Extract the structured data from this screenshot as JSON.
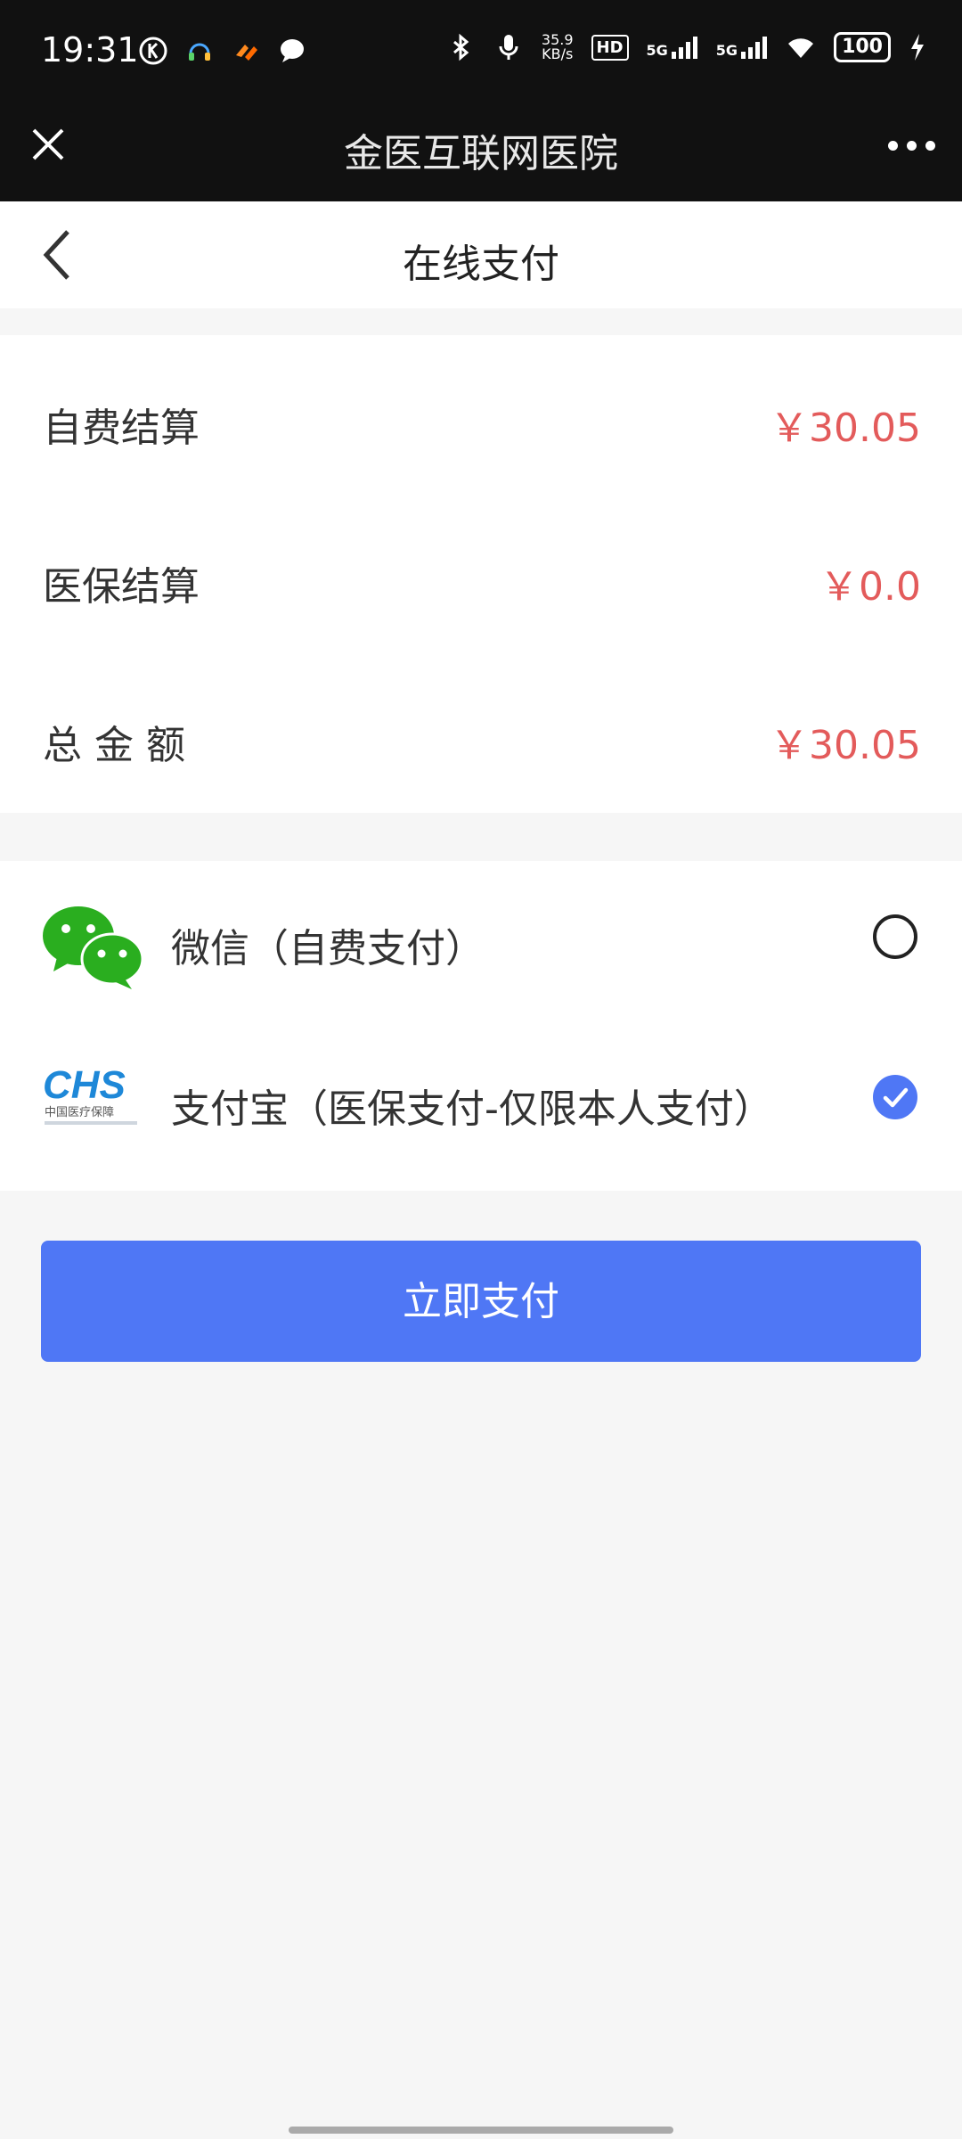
{
  "status_bar": {
    "time": "19:31",
    "net_speed_value": "35.9",
    "net_speed_unit": "KB/s",
    "hd_label": "HD",
    "sim1_label": "5G",
    "sim2_label": "5G",
    "battery": "100",
    "left_icons": [
      "k-circle-icon",
      "headset-icon",
      "taobao-icon",
      "chat-bubble-icon"
    ],
    "right_icons": [
      "bluetooth-icon",
      "mic-icon",
      "wifi-icon",
      "charging-icon"
    ]
  },
  "wx_header": {
    "title": "金医互联网医院"
  },
  "page": {
    "title": "在线支付"
  },
  "summary": {
    "rows": [
      {
        "label": "自费结算",
        "value": "￥30.05"
      },
      {
        "label": "医保结算",
        "value": "￥0.0"
      },
      {
        "label": "总 金 额",
        "value": "￥30.05"
      }
    ]
  },
  "methods": [
    {
      "label": "微信（自费支付）",
      "icon": "wechat-logo-icon",
      "selected": false
    },
    {
      "label": "支付宝（医保支付-仅限本人支付）",
      "icon": "chs-logo-icon",
      "selected": true
    }
  ],
  "chs_logo_caption": "中国医疗保障",
  "pay_button_label": "立即支付",
  "colors": {
    "accent": "#4f77f5",
    "amount": "#e35b5b",
    "wechat_green": "#2aae1f",
    "chs_blue": "#1e88d8"
  }
}
